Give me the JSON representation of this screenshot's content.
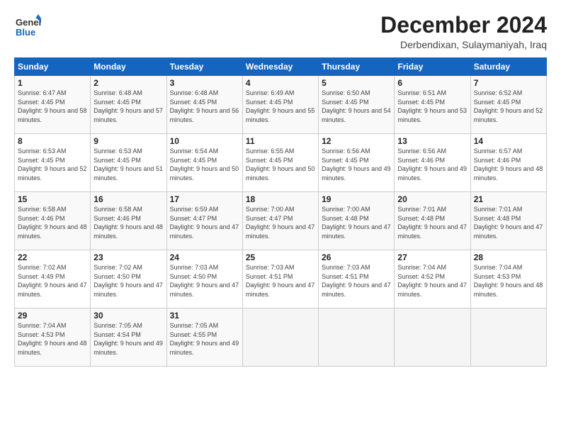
{
  "header": {
    "logo_general": "General",
    "logo_blue": "Blue",
    "month": "December 2024",
    "location": "Derbendixan, Sulaymaniyah, Iraq"
  },
  "days_of_week": [
    "Sunday",
    "Monday",
    "Tuesday",
    "Wednesday",
    "Thursday",
    "Friday",
    "Saturday"
  ],
  "weeks": [
    [
      {
        "day": "1",
        "sunrise": "6:47 AM",
        "sunset": "4:45 PM",
        "daylight": "9 hours and 58 minutes."
      },
      {
        "day": "2",
        "sunrise": "6:48 AM",
        "sunset": "4:45 PM",
        "daylight": "9 hours and 57 minutes."
      },
      {
        "day": "3",
        "sunrise": "6:48 AM",
        "sunset": "4:45 PM",
        "daylight": "9 hours and 56 minutes."
      },
      {
        "day": "4",
        "sunrise": "6:49 AM",
        "sunset": "4:45 PM",
        "daylight": "9 hours and 55 minutes."
      },
      {
        "day": "5",
        "sunrise": "6:50 AM",
        "sunset": "4:45 PM",
        "daylight": "9 hours and 54 minutes."
      },
      {
        "day": "6",
        "sunrise": "6:51 AM",
        "sunset": "4:45 PM",
        "daylight": "9 hours and 53 minutes."
      },
      {
        "day": "7",
        "sunrise": "6:52 AM",
        "sunset": "4:45 PM",
        "daylight": "9 hours and 52 minutes."
      }
    ],
    [
      {
        "day": "8",
        "sunrise": "6:53 AM",
        "sunset": "4:45 PM",
        "daylight": "9 hours and 52 minutes."
      },
      {
        "day": "9",
        "sunrise": "6:53 AM",
        "sunset": "4:45 PM",
        "daylight": "9 hours and 51 minutes."
      },
      {
        "day": "10",
        "sunrise": "6:54 AM",
        "sunset": "4:45 PM",
        "daylight": "9 hours and 50 minutes."
      },
      {
        "day": "11",
        "sunrise": "6:55 AM",
        "sunset": "4:45 PM",
        "daylight": "9 hours and 50 minutes."
      },
      {
        "day": "12",
        "sunrise": "6:56 AM",
        "sunset": "4:45 PM",
        "daylight": "9 hours and 49 minutes."
      },
      {
        "day": "13",
        "sunrise": "6:56 AM",
        "sunset": "4:46 PM",
        "daylight": "9 hours and 49 minutes."
      },
      {
        "day": "14",
        "sunrise": "6:57 AM",
        "sunset": "4:46 PM",
        "daylight": "9 hours and 48 minutes."
      }
    ],
    [
      {
        "day": "15",
        "sunrise": "6:58 AM",
        "sunset": "4:46 PM",
        "daylight": "9 hours and 48 minutes."
      },
      {
        "day": "16",
        "sunrise": "6:58 AM",
        "sunset": "4:46 PM",
        "daylight": "9 hours and 48 minutes."
      },
      {
        "day": "17",
        "sunrise": "6:59 AM",
        "sunset": "4:47 PM",
        "daylight": "9 hours and 47 minutes."
      },
      {
        "day": "18",
        "sunrise": "7:00 AM",
        "sunset": "4:47 PM",
        "daylight": "9 hours and 47 minutes."
      },
      {
        "day": "19",
        "sunrise": "7:00 AM",
        "sunset": "4:48 PM",
        "daylight": "9 hours and 47 minutes."
      },
      {
        "day": "20",
        "sunrise": "7:01 AM",
        "sunset": "4:48 PM",
        "daylight": "9 hours and 47 minutes."
      },
      {
        "day": "21",
        "sunrise": "7:01 AM",
        "sunset": "4:48 PM",
        "daylight": "9 hours and 47 minutes."
      }
    ],
    [
      {
        "day": "22",
        "sunrise": "7:02 AM",
        "sunset": "4:49 PM",
        "daylight": "9 hours and 47 minutes."
      },
      {
        "day": "23",
        "sunrise": "7:02 AM",
        "sunset": "4:50 PM",
        "daylight": "9 hours and 47 minutes."
      },
      {
        "day": "24",
        "sunrise": "7:03 AM",
        "sunset": "4:50 PM",
        "daylight": "9 hours and 47 minutes."
      },
      {
        "day": "25",
        "sunrise": "7:03 AM",
        "sunset": "4:51 PM",
        "daylight": "9 hours and 47 minutes."
      },
      {
        "day": "26",
        "sunrise": "7:03 AM",
        "sunset": "4:51 PM",
        "daylight": "9 hours and 47 minutes."
      },
      {
        "day": "27",
        "sunrise": "7:04 AM",
        "sunset": "4:52 PM",
        "daylight": "9 hours and 47 minutes."
      },
      {
        "day": "28",
        "sunrise": "7:04 AM",
        "sunset": "4:53 PM",
        "daylight": "9 hours and 48 minutes."
      }
    ],
    [
      {
        "day": "29",
        "sunrise": "7:04 AM",
        "sunset": "4:53 PM",
        "daylight": "9 hours and 48 minutes."
      },
      {
        "day": "30",
        "sunrise": "7:05 AM",
        "sunset": "4:54 PM",
        "daylight": "9 hours and 49 minutes."
      },
      {
        "day": "31",
        "sunrise": "7:05 AM",
        "sunset": "4:55 PM",
        "daylight": "9 hours and 49 minutes."
      },
      null,
      null,
      null,
      null
    ]
  ]
}
